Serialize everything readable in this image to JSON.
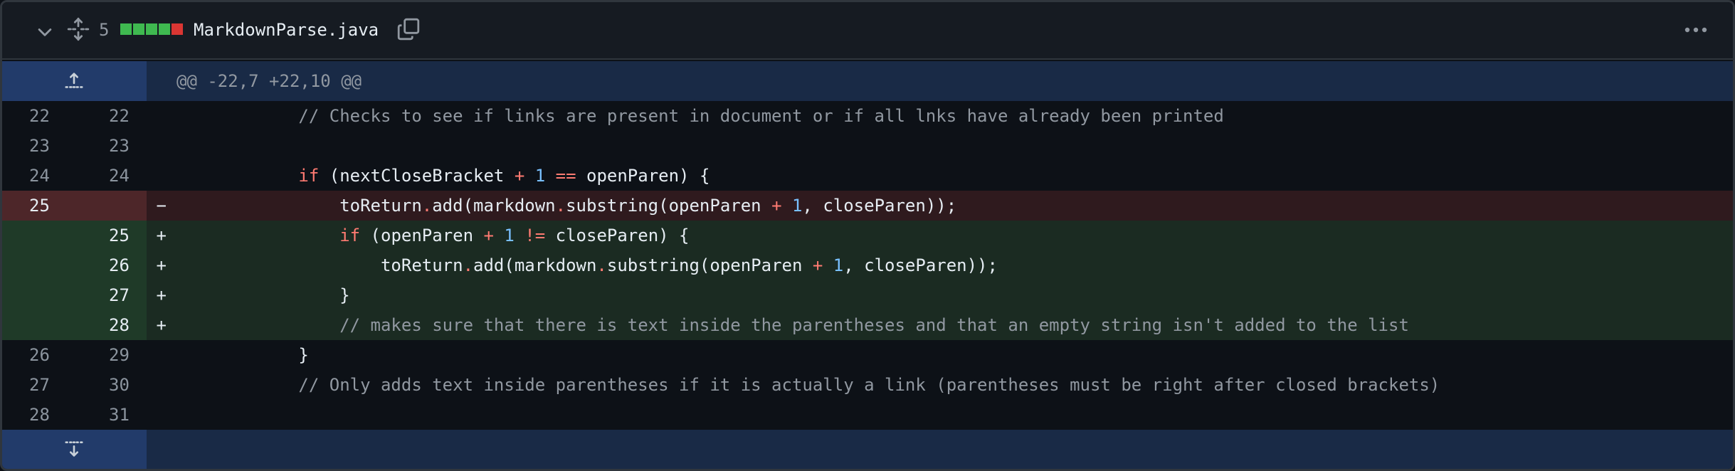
{
  "header": {
    "change_count": "5",
    "diffstat": [
      "#3fb950",
      "#3fb950",
      "#3fb950",
      "#3fb950",
      "#da3633"
    ],
    "filename": "MarkdownParse.java"
  },
  "hunk": {
    "label": "@@ -22,7 +22,10 @@"
  },
  "lines": [
    {
      "type": "ctx",
      "old": "22",
      "new": "22",
      "marker": "",
      "code": [
        {
          "t": "            ",
          "c": ""
        },
        {
          "t": "// Checks to see if links are present in document or if all lnks have already been printed",
          "c": "cm"
        }
      ]
    },
    {
      "type": "ctx",
      "old": "23",
      "new": "23",
      "marker": "",
      "code": [
        {
          "t": "",
          "c": ""
        }
      ]
    },
    {
      "type": "ctx",
      "old": "24",
      "new": "24",
      "marker": "",
      "code": [
        {
          "t": "            ",
          "c": ""
        },
        {
          "t": "if",
          "c": "kw"
        },
        {
          "t": " (nextCloseBracket ",
          "c": ""
        },
        {
          "t": "+",
          "c": "op"
        },
        {
          "t": " ",
          "c": ""
        },
        {
          "t": "1",
          "c": "num"
        },
        {
          "t": " ",
          "c": ""
        },
        {
          "t": "==",
          "c": "op"
        },
        {
          "t": " openParen) {",
          "c": ""
        }
      ]
    },
    {
      "type": "del",
      "old": "25",
      "new": "",
      "marker": "−",
      "code": [
        {
          "t": "                toReturn",
          "c": ""
        },
        {
          "t": ".",
          "c": "dot"
        },
        {
          "t": "add(markdown",
          "c": ""
        },
        {
          "t": ".",
          "c": "dot"
        },
        {
          "t": "substring(openParen ",
          "c": ""
        },
        {
          "t": "+",
          "c": "op"
        },
        {
          "t": " ",
          "c": ""
        },
        {
          "t": "1",
          "c": "num"
        },
        {
          "t": ", closeParen));",
          "c": ""
        }
      ]
    },
    {
      "type": "add",
      "old": "",
      "new": "25",
      "marker": "+",
      "code": [
        {
          "t": "                ",
          "c": ""
        },
        {
          "t": "if",
          "c": "kw"
        },
        {
          "t": " (openParen ",
          "c": ""
        },
        {
          "t": "+",
          "c": "op"
        },
        {
          "t": " ",
          "c": ""
        },
        {
          "t": "1",
          "c": "num"
        },
        {
          "t": " ",
          "c": ""
        },
        {
          "t": "!=",
          "c": "op"
        },
        {
          "t": " closeParen) {",
          "c": ""
        }
      ]
    },
    {
      "type": "add",
      "old": "",
      "new": "26",
      "marker": "+",
      "code": [
        {
          "t": "                    toReturn",
          "c": ""
        },
        {
          "t": ".",
          "c": "dot"
        },
        {
          "t": "add(markdown",
          "c": ""
        },
        {
          "t": ".",
          "c": "dot"
        },
        {
          "t": "substring(openParen ",
          "c": ""
        },
        {
          "t": "+",
          "c": "op"
        },
        {
          "t": " ",
          "c": ""
        },
        {
          "t": "1",
          "c": "num"
        },
        {
          "t": ", closeParen));",
          "c": ""
        }
      ]
    },
    {
      "type": "add",
      "old": "",
      "new": "27",
      "marker": "+",
      "code": [
        {
          "t": "                }",
          "c": ""
        }
      ]
    },
    {
      "type": "add",
      "old": "",
      "new": "28",
      "marker": "+",
      "code": [
        {
          "t": "                ",
          "c": ""
        },
        {
          "t": "// makes sure that there is text inside the parentheses and that an empty string isn't added to the list",
          "c": "cm"
        }
      ]
    },
    {
      "type": "ctx",
      "old": "26",
      "new": "29",
      "marker": "",
      "code": [
        {
          "t": "            }",
          "c": ""
        }
      ]
    },
    {
      "type": "ctx",
      "old": "27",
      "new": "30",
      "marker": "",
      "code": [
        {
          "t": "            ",
          "c": ""
        },
        {
          "t": "// Only adds text inside parentheses if it is actually a link (parentheses must be right after closed brackets)",
          "c": "cm"
        }
      ]
    },
    {
      "type": "ctx",
      "old": "28",
      "new": "31",
      "marker": "",
      "code": [
        {
          "t": "",
          "c": ""
        }
      ]
    }
  ]
}
